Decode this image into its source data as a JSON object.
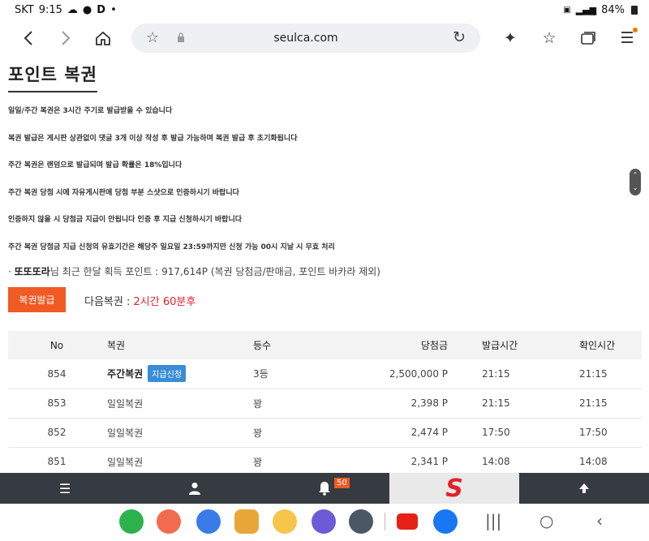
{
  "status": {
    "carrier": "SKT",
    "time": "9:15",
    "battery": "84%"
  },
  "browser": {
    "url": "seulca.com"
  },
  "page": {
    "title": "포인트 복권",
    "notices": [
      "일일/주간 복권은 3시간 주기로 발급받을 수 있습니다",
      "복권 발급은 게시판 상관없이 댓글 3개 이상 작성 후 발급 가능하며 복권 발급 후 초기화됩니다",
      "주간 복권은 랜덤으로 발급되며 발급 확률은 18%입니다",
      "주간 복권 당첨 시에 자유게시판에 당첨 부분 스샷으로 인증하시기 바랍니다",
      "인증하지 않을 시 당첨금 지급이 안됩니다 인증 후 지급 신청하시기 바랍니다",
      "주간 복권 당첨금 지급 신청의 유효기간은 해당주 일요일 23:59까지만 신청 가능 00시 지날 시 무효 처리"
    ],
    "points": {
      "prefix": "· ",
      "nickname": "또또또라",
      "text": "님 최근 한달 획득 포인트 : 917,614P (복권 당첨금/판매금, 포인트 바카라 제외)"
    },
    "issue_button": "복권발급",
    "next_lotto_label": "다음복권 : ",
    "next_lotto_time": "2시간 60분후",
    "table": {
      "headers": [
        "No",
        "복권",
        "등수",
        "당첨금",
        "발급시간",
        "확인시간"
      ],
      "rows": [
        {
          "no": "854",
          "name": "주간복권",
          "badge": "지급신청",
          "rank": "3등",
          "prize": "2,500,000 P",
          "issued": "21:15",
          "checked": "21:15"
        },
        {
          "no": "853",
          "name": "일일복권",
          "badge": "",
          "rank": "꽝",
          "prize": "2,398 P",
          "issued": "21:15",
          "checked": "21:15"
        },
        {
          "no": "852",
          "name": "일일복권",
          "badge": "",
          "rank": "꽝",
          "prize": "2,474 P",
          "issued": "17:50",
          "checked": "17:50"
        },
        {
          "no": "851",
          "name": "일일복권",
          "badge": "",
          "rank": "꽝",
          "prize": "2,341 P",
          "issued": "14:08",
          "checked": "14:08"
        }
      ]
    }
  },
  "site_nav": {
    "bell_count": "50",
    "logo_letter": "S"
  },
  "colors": {
    "accent": "#f05a23",
    "red_text": "#e4202a",
    "badge_blue": "#3a8dd8",
    "nav_bg": "#363b41"
  }
}
